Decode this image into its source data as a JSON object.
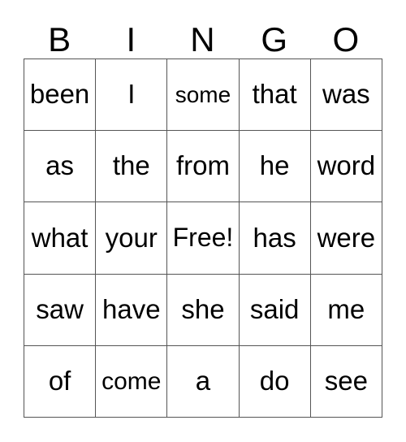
{
  "card": {
    "columns": [
      "B",
      "I",
      "N",
      "G",
      "O"
    ],
    "free_space_label": "Free!",
    "free_space_position": {
      "row": 2,
      "col": 2
    },
    "grid": [
      [
        "been",
        "I",
        "some",
        "that",
        "was"
      ],
      [
        "as",
        "the",
        "from",
        "he",
        "word"
      ],
      [
        "what",
        "your",
        "Free!",
        "has",
        "were"
      ],
      [
        "saw",
        "have",
        "she",
        "said",
        "me"
      ],
      [
        "of",
        "come",
        "a",
        "do",
        "see"
      ]
    ],
    "colors": {
      "background": "#ffffff",
      "text": "#000000",
      "border": "#555555"
    }
  }
}
